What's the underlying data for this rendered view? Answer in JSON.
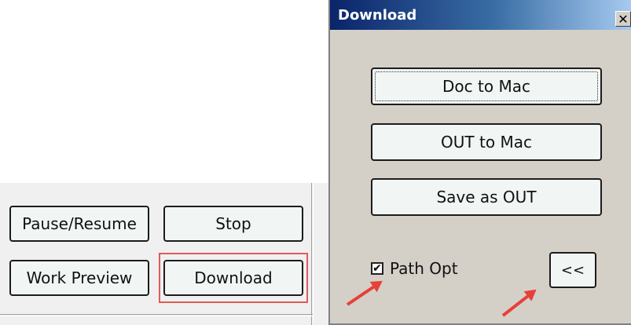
{
  "left_panel": {
    "buttons": {
      "pause_resume": "Pause/Resume",
      "stop": "Stop",
      "work_preview": "Work Preview",
      "download": "Download"
    }
  },
  "dialog": {
    "title": "Download",
    "close_glyph": "✕",
    "buttons": {
      "doc_to_mac": "Doc to Mac",
      "out_to_mac": "OUT to Mac",
      "save_as_out": "Save as OUT",
      "collapse": "<<"
    },
    "checkbox": {
      "label": "Path Opt",
      "checked": true,
      "check_glyph": "✔"
    }
  },
  "annotations": {
    "highlight_color": "#e05a5a",
    "arrow_color": "#e8403a"
  }
}
